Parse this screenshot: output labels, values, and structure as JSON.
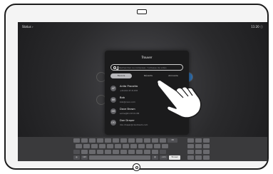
{
  "status": {
    "left": "Status  ›",
    "right": "11:20  ⓘ"
  },
  "dialog": {
    "title": "Trouver",
    "search_placeholder": "Rechercher ou composer, l'adresse de vidéo",
    "tabs": [
      "Favoris",
      "Récents",
      "Annuaire"
    ]
  },
  "contacts": [
    {
      "initials": "AP",
      "name": "Anita Procotto",
      "detail": "+41(0)1 67.8.158"
    },
    {
      "initials": "BB",
      "name": "Bob",
      "detail": "bob@cisco.com"
    },
    {
      "initials": "DB",
      "name": "Dave Brown",
      "detail": "some@61 67.8.158"
    },
    {
      "initials": "DD",
      "name": "Don Draper",
      "detail": "don.draper@ciscoteam.com"
    }
  ],
  "keyboard": {
    "row_special": [
      "⌫",
      "@",
      ".com",
      "Trouver"
    ],
    "key_123": "123",
    "colors": {
      "keys": "#6a6a6e",
      "action": "#e6e6e6"
    }
  }
}
